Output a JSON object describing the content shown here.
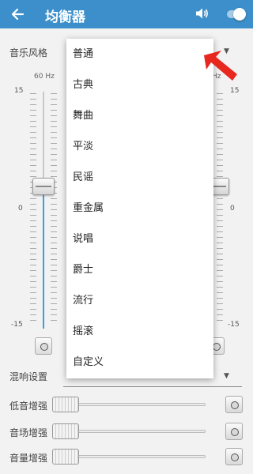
{
  "appbar": {
    "back_icon": "back-arrow-icon",
    "title": "均衡器",
    "volume_icon": "volume-icon",
    "enabled": true,
    "bg_color": "#3c8fca"
  },
  "style": {
    "label": "音乐风格",
    "arrow": "▼"
  },
  "eq": {
    "left_freq": "60 Hz",
    "right_freq_fragment": "Hz",
    "scale_top": "15",
    "scale_mid": "0",
    "scale_bottom": "-15",
    "left_band_level": 0,
    "fill_color": "#3aa0e0"
  },
  "reverb": {
    "label": "混响设置",
    "arrow": "▼"
  },
  "effects": [
    {
      "label": "低音增强",
      "value": 0
    },
    {
      "label": "音场增强",
      "value": 0
    },
    {
      "label": "音量增强",
      "value": 0
    }
  ],
  "dropdown": {
    "items": [
      "普通",
      "古典",
      "舞曲",
      "平淡",
      "民谣",
      "重金属",
      "说唱",
      "爵士",
      "流行",
      "摇滚",
      "自定义"
    ]
  },
  "annotation": {
    "arrow_color": "#e8271f"
  }
}
